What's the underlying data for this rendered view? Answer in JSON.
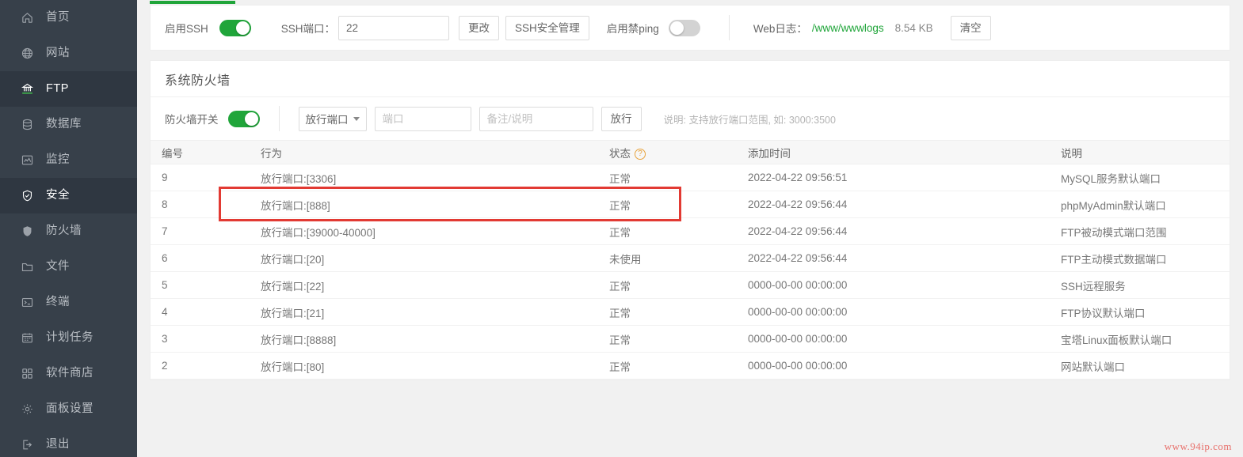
{
  "sidebar": {
    "items": [
      {
        "label": "首页",
        "icon": "home-icon",
        "active": false
      },
      {
        "label": "网站",
        "icon": "globe-icon",
        "active": false
      },
      {
        "label": "FTP",
        "icon": "ftp-icon",
        "active": true
      },
      {
        "label": "数据库",
        "icon": "database-icon",
        "active": false
      },
      {
        "label": "监控",
        "icon": "monitor-icon",
        "active": false
      },
      {
        "label": "安全",
        "icon": "shield-check-icon",
        "active": true
      },
      {
        "label": "防火墙",
        "icon": "shield-solid-icon",
        "active": false
      },
      {
        "label": "文件",
        "icon": "folder-icon",
        "active": false
      },
      {
        "label": "终端",
        "icon": "terminal-icon",
        "active": false
      },
      {
        "label": "计划任务",
        "icon": "calendar-icon",
        "active": false
      },
      {
        "label": "软件商店",
        "icon": "grid-icon",
        "active": false
      },
      {
        "label": "面板设置",
        "icon": "gear-icon",
        "active": false
      },
      {
        "label": "退出",
        "icon": "logout-icon",
        "active": false
      }
    ]
  },
  "ssh_bar": {
    "enable_ssh_label": "启用SSH",
    "enable_ssh_on": true,
    "port_label": "SSH端口：",
    "port_value": "22",
    "change_button": "更改",
    "ssh_security_button": "SSH安全管理",
    "disable_ping_label": "启用禁ping",
    "disable_ping_on": false,
    "weblog_label": "Web日志：",
    "weblog_path": "/www/wwwlogs",
    "weblog_size": "8.54 KB",
    "clear_button": "清空"
  },
  "firewall": {
    "title": "系统防火墙",
    "switch_label": "防火墙开关",
    "switch_on": true,
    "type_select": "放行端口",
    "port_placeholder": "端口",
    "port_value": "",
    "note_placeholder": "备注/说明",
    "note_value": "",
    "allow_button": "放行",
    "hint": "说明: 支持放行端口范围, 如: 3000:3500",
    "columns": [
      "编号",
      "行为",
      "状态",
      "添加时间",
      "说明"
    ],
    "status_help_icon": "?",
    "rows": [
      {
        "id": "9",
        "action": "放行端口:[3306]",
        "status": "正常",
        "time": "2022-04-22 09:56:51",
        "desc": "MySQL服务默认端口"
      },
      {
        "id": "8",
        "action": "放行端口:[888]",
        "status": "正常",
        "time": "2022-04-22 09:56:44",
        "desc": "phpMyAdmin默认端口"
      },
      {
        "id": "7",
        "action": "放行端口:[39000-40000]",
        "status": "正常",
        "time": "2022-04-22 09:56:44",
        "desc": "FTP被动模式端口范围"
      },
      {
        "id": "6",
        "action": "放行端口:[20]",
        "status": "未使用",
        "time": "2022-04-22 09:56:44",
        "desc": "FTP主动模式数据端口"
      },
      {
        "id": "5",
        "action": "放行端口:[22]",
        "status": "正常",
        "time": "0000-00-00 00:00:00",
        "desc": "SSH远程服务"
      },
      {
        "id": "4",
        "action": "放行端口:[21]",
        "status": "正常",
        "time": "0000-00-00 00:00:00",
        "desc": "FTP协议默认端口"
      },
      {
        "id": "3",
        "action": "放行端口:[8888]",
        "status": "正常",
        "time": "0000-00-00 00:00:00",
        "desc": "宝塔Linux面板默认端口"
      },
      {
        "id": "2",
        "action": "放行端口:[80]",
        "status": "正常",
        "time": "0000-00-00 00:00:00",
        "desc": "网站默认端口"
      }
    ]
  },
  "annotation": {
    "highlight_row_id": "9"
  },
  "watermark": {
    "text": "www.94ip.com"
  },
  "colors": {
    "accent_green": "#20a53a",
    "sidebar_bg": "#37404a",
    "sidebar_active_bg": "#2f3741",
    "annotation_red": "#e23a33"
  }
}
